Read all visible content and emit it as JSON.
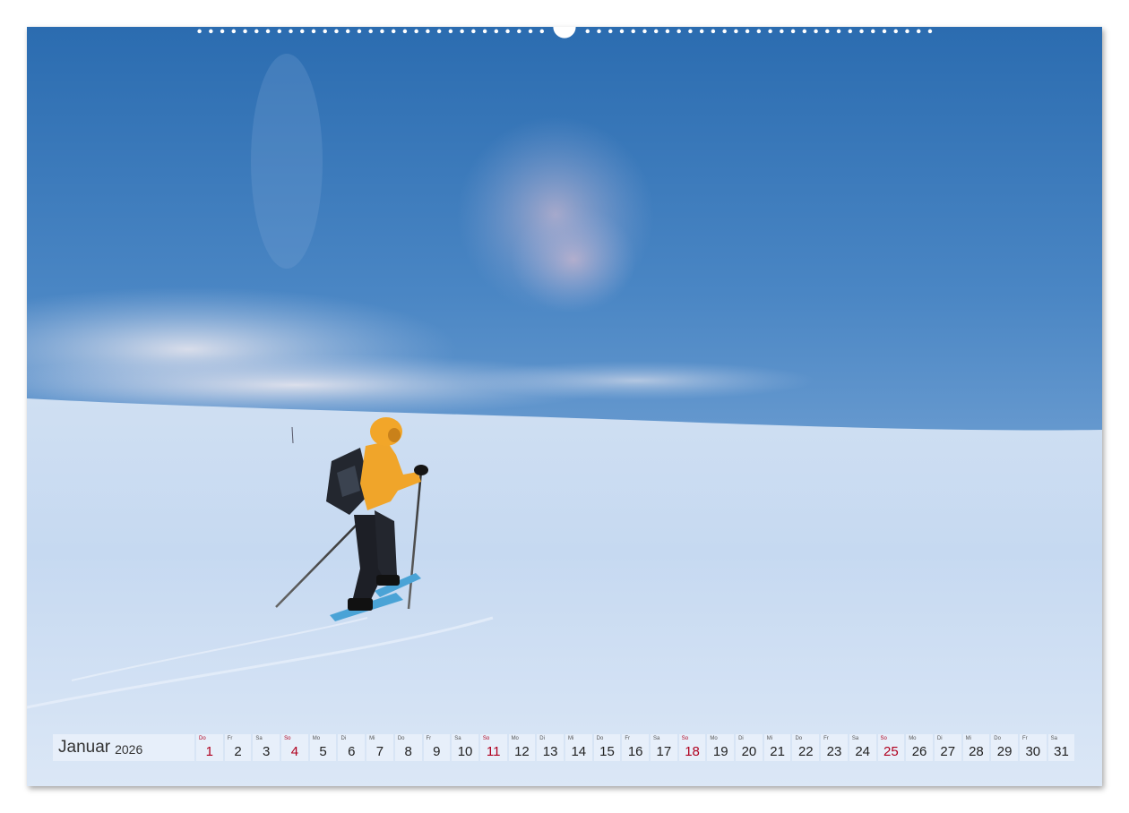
{
  "calendar": {
    "month": "Januar",
    "year": "2026",
    "days": [
      {
        "wd": "Do",
        "n": "1",
        "sunday": true
      },
      {
        "wd": "Fr",
        "n": "2"
      },
      {
        "wd": "Sa",
        "n": "3"
      },
      {
        "wd": "So",
        "n": "4",
        "sunday": true
      },
      {
        "wd": "Mo",
        "n": "5"
      },
      {
        "wd": "Di",
        "n": "6"
      },
      {
        "wd": "Mi",
        "n": "7"
      },
      {
        "wd": "Do",
        "n": "8"
      },
      {
        "wd": "Fr",
        "n": "9"
      },
      {
        "wd": "Sa",
        "n": "10"
      },
      {
        "wd": "So",
        "n": "11",
        "sunday": true
      },
      {
        "wd": "Mo",
        "n": "12"
      },
      {
        "wd": "Di",
        "n": "13"
      },
      {
        "wd": "Mi",
        "n": "14"
      },
      {
        "wd": "Do",
        "n": "15"
      },
      {
        "wd": "Fr",
        "n": "16"
      },
      {
        "wd": "Sa",
        "n": "17"
      },
      {
        "wd": "So",
        "n": "18",
        "sunday": true
      },
      {
        "wd": "Mo",
        "n": "19"
      },
      {
        "wd": "Di",
        "n": "20"
      },
      {
        "wd": "Mi",
        "n": "21"
      },
      {
        "wd": "Do",
        "n": "22"
      },
      {
        "wd": "Fr",
        "n": "23"
      },
      {
        "wd": "Sa",
        "n": "24"
      },
      {
        "wd": "So",
        "n": "25",
        "sunday": true
      },
      {
        "wd": "Mo",
        "n": "26"
      },
      {
        "wd": "Di",
        "n": "27"
      },
      {
        "wd": "Mi",
        "n": "28"
      },
      {
        "wd": "Do",
        "n": "29"
      },
      {
        "wd": "Fr",
        "n": "30"
      },
      {
        "wd": "Sa",
        "n": "31"
      }
    ]
  },
  "colors": {
    "sunday": "#b0001e",
    "sky_top": "#2f6fb2",
    "snow": "#dce8f6",
    "jacket": "#f0a52a"
  },
  "icons": {
    "binding": "spiral-binding-holes",
    "hanger": "hanger-notch"
  }
}
